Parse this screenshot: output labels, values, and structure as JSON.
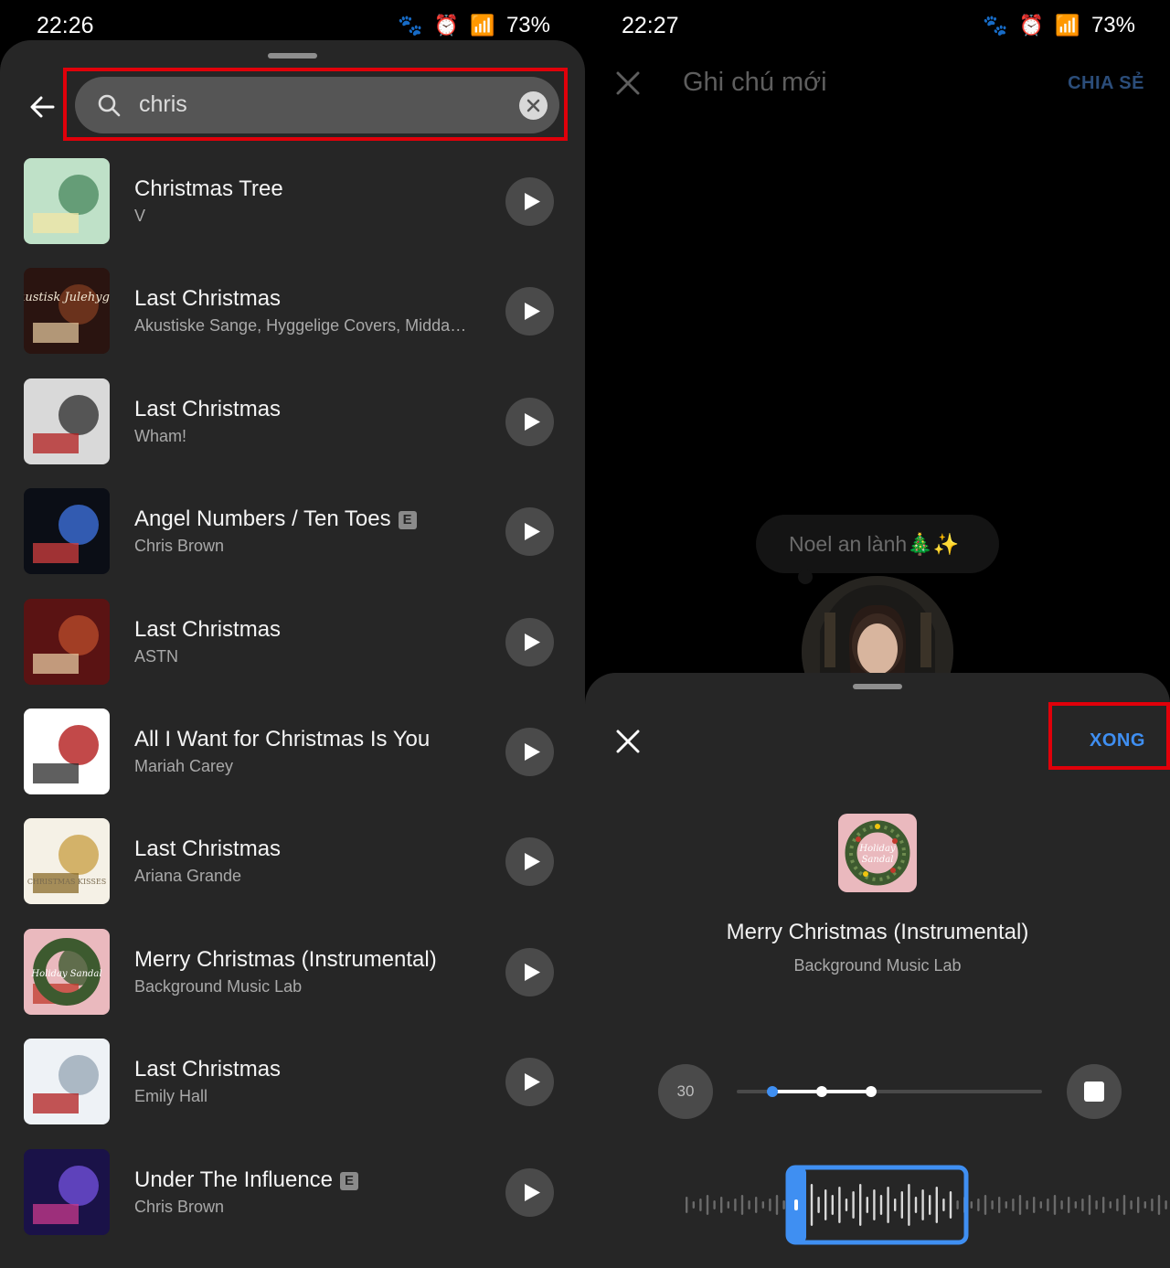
{
  "left": {
    "status": {
      "time": "22:26",
      "battery": "73%"
    },
    "search": {
      "query": "chris"
    },
    "songs": [
      {
        "title": "Christmas Tree",
        "artist": "V",
        "explicit": false
      },
      {
        "title": "Last Christmas",
        "artist": "Akustiske Sange, Hyggelige Covers, Middag O...",
        "explicit": false
      },
      {
        "title": "Last Christmas",
        "artist": "Wham!",
        "explicit": false
      },
      {
        "title": "Angel Numbers / Ten Toes",
        "artist": "Chris Brown",
        "explicit": true
      },
      {
        "title": "Last Christmas",
        "artist": "ASTN",
        "explicit": false
      },
      {
        "title": "All I Want for Christmas Is You",
        "artist": "Mariah Carey",
        "explicit": false
      },
      {
        "title": "Last Christmas",
        "artist": "Ariana Grande",
        "explicit": false
      },
      {
        "title": "Merry Christmas (Instrumental)",
        "artist": "Background Music Lab",
        "explicit": false
      },
      {
        "title": "Last Christmas",
        "artist": "Emily Hall",
        "explicit": false
      },
      {
        "title": "Under The Influence",
        "artist": "Chris Brown",
        "explicit": true
      }
    ],
    "explicit_label": "E",
    "cover_art_texts": [
      "Akustisk Julehygge",
      "CHRISTMAS KISSES",
      "Holiday Sandal"
    ]
  },
  "right": {
    "status": {
      "time": "22:27",
      "battery": "73%"
    },
    "topbar": {
      "title": "Ghi chú mới",
      "share_label": "CHIA SẺ"
    },
    "note": {
      "text": "Noel an lành🎄✨"
    },
    "sheet": {
      "done_label": "XONG",
      "song_title": "Merry Christmas (Instrumental)",
      "song_artist": "Background Music Lab",
      "duration": "30",
      "duration_steps": 3,
      "selected_step": 1
    }
  },
  "colors": {
    "highlight": "#e0000a",
    "accent_blue": "#3f8ff2",
    "sheet_bg": "#262626"
  }
}
